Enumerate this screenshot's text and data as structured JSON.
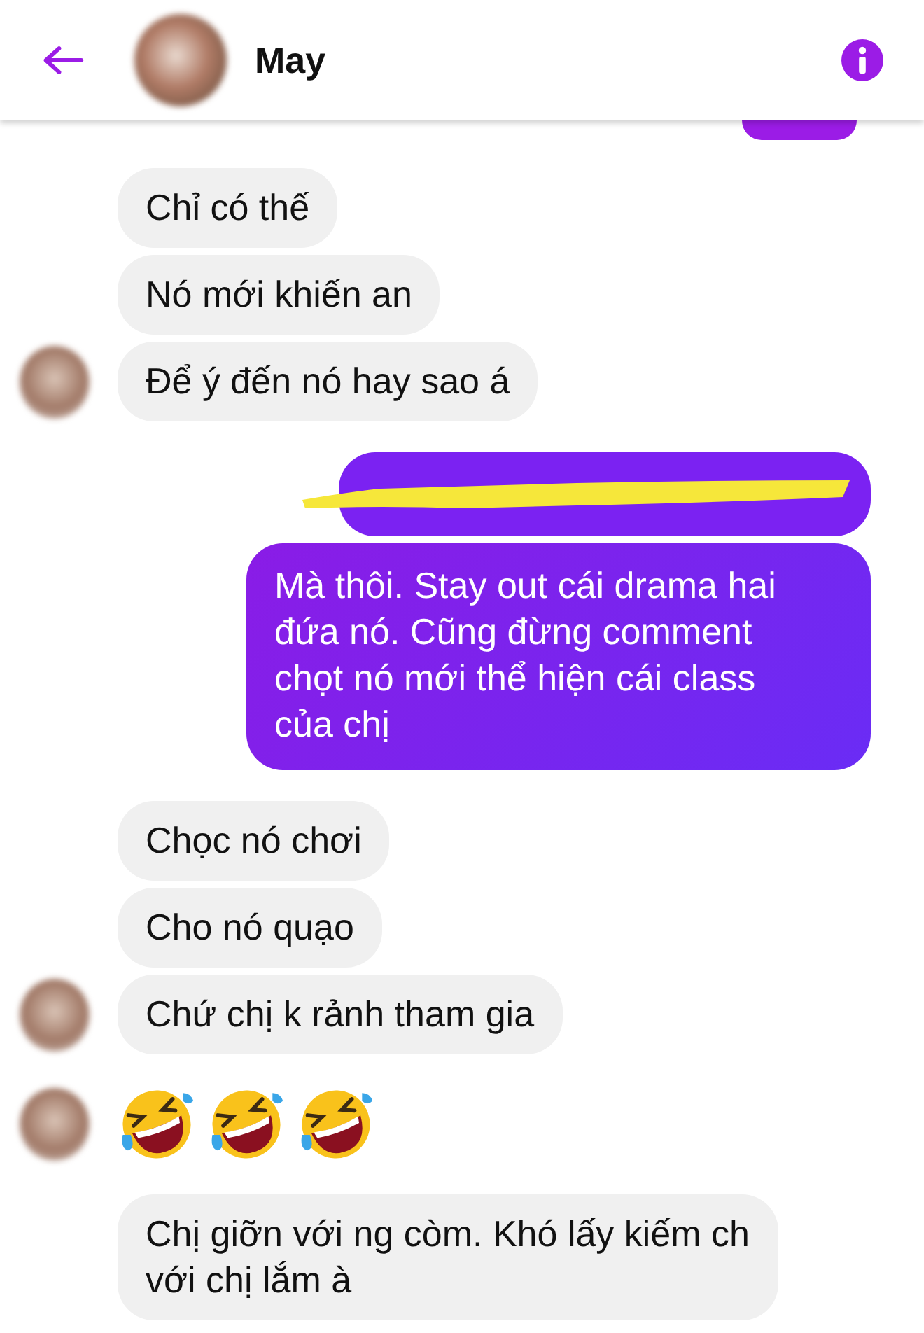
{
  "header": {
    "title": "May"
  },
  "messages": [
    {
      "kind": "sent-edge"
    },
    {
      "kind": "received",
      "text": "Chỉ có thế",
      "avatar": false
    },
    {
      "kind": "received",
      "text": "Nó mới khiến an",
      "avatar": false
    },
    {
      "kind": "received",
      "text": "Để ý đến nó hay sao á",
      "avatar": true
    },
    {
      "kind": "redacted"
    },
    {
      "kind": "sent",
      "text": "Mà thôi. Stay out cái drama hai đứa nó. Cũng đừng comment chọt nó mới thể hiện cái class của chị"
    },
    {
      "kind": "received",
      "text": "Chọc nó chơi",
      "avatar": false
    },
    {
      "kind": "received",
      "text": "Cho nó quạo",
      "avatar": false
    },
    {
      "kind": "received",
      "text": "Chứ chị k rảnh tham gia",
      "avatar": true
    },
    {
      "kind": "emoji",
      "avatar": true,
      "emojis": [
        {
          "kind": "laughing"
        },
        {
          "kind": "laughing"
        },
        {
          "kind": "laughing"
        }
      ]
    },
    {
      "kind": "received",
      "text": "Chị giỡn với ng còm. Khó lấy kiếm ch với chị lắm à",
      "avatar": false
    }
  ]
}
